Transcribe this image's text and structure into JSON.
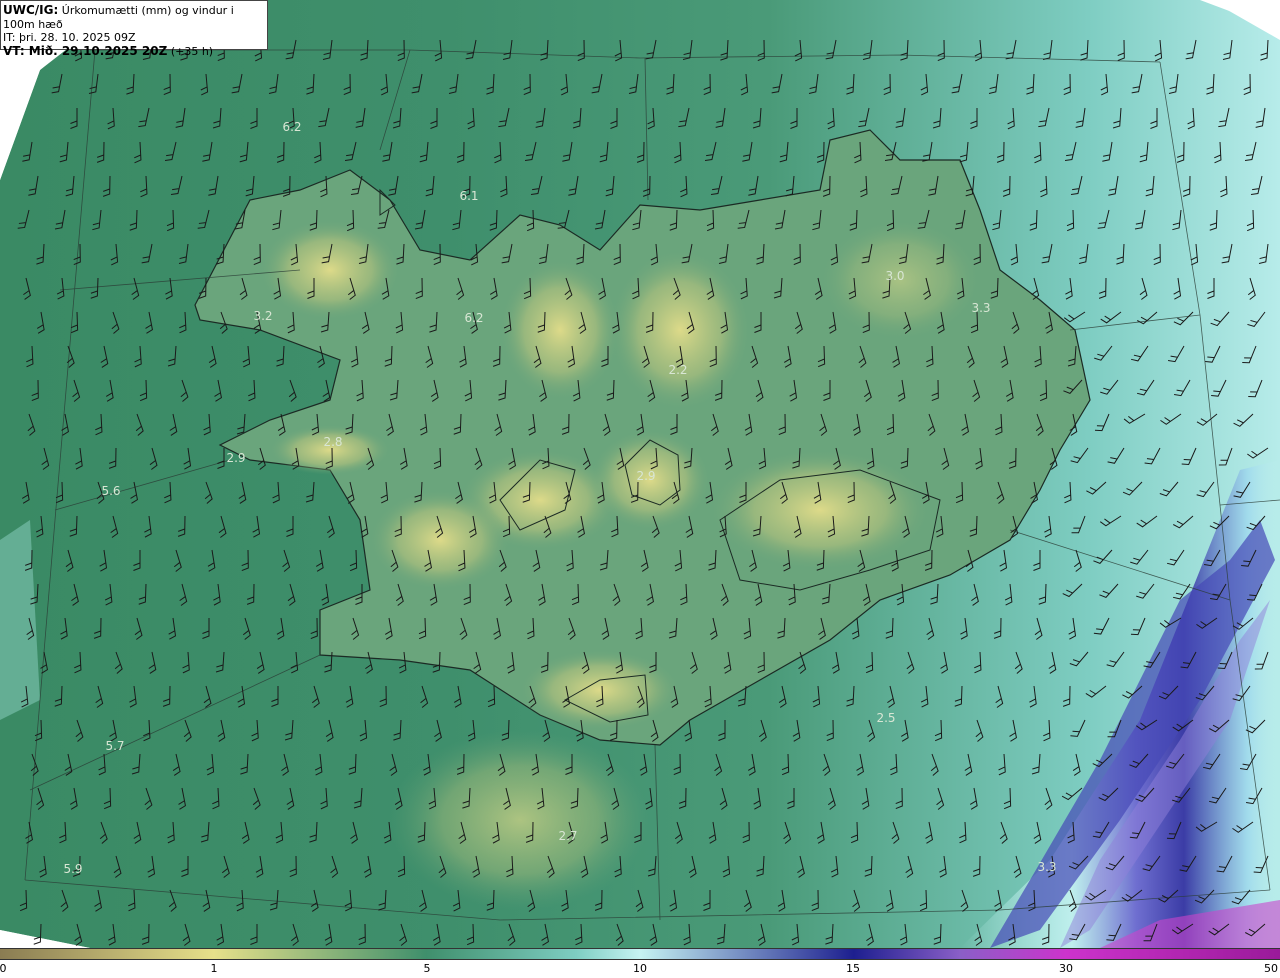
{
  "title": {
    "prefix": "UWC/IG:",
    "text": "Úrkomumætti (mm) og vindur i 100m hæð",
    "it_line": "IT: þri. 28. 10. 2025 09Z",
    "vt_prefix": "VT: Mið. 29.10.2025 20Z",
    "vt_suffix": "(+35 h)"
  },
  "colors": {
    "low": "#8a7c52",
    "yellow": "#e6e08a",
    "green": "#3f8f6c",
    "teal": "#7ecdc2",
    "cyan": "#c6f3f2",
    "navy": "#1d1f8f",
    "violet": "#8a5fc7",
    "magenta": "#cc33cc",
    "purple": "#9a1a9a"
  },
  "colorbar": {
    "labels": [
      "0",
      "1",
      "5",
      "10",
      "15",
      "30",
      "50"
    ]
  },
  "map_values": [
    {
      "label": "6.2"
    },
    {
      "label": "6.1"
    },
    {
      "label": "3.2"
    },
    {
      "label": "6.2"
    },
    {
      "label": "2.2"
    },
    {
      "label": "3.0"
    },
    {
      "label": "3.3"
    },
    {
      "label": "2.8"
    },
    {
      "label": "2.9"
    },
    {
      "label": "5.6"
    },
    {
      "label": "2.9"
    },
    {
      "label": "2.5"
    },
    {
      "label": "5.7"
    },
    {
      "label": "2.7"
    },
    {
      "label": "5.9"
    },
    {
      "label": "3.3"
    }
  ],
  "wind": {
    "legend": "wind barbs at 100m"
  }
}
